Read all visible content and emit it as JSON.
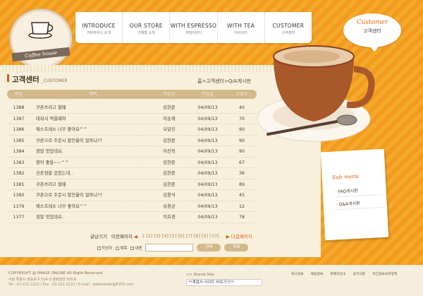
{
  "logo": {
    "brand": "Coffee house"
  },
  "nav": [
    {
      "en": "INTRODUCE",
      "ko": "커피하우스 소개"
    },
    {
      "en": "OUR STORE",
      "ko": "가맹점 소개"
    },
    {
      "en": "WITH ESPRESSO",
      "ko": "커피이야기"
    },
    {
      "en": "WITH TEA",
      "ko": "티이야기"
    },
    {
      "en": "CUSTOMER",
      "ko": "고객센터"
    }
  ],
  "bubble": {
    "en": "Customer",
    "ko": "고객센터"
  },
  "page": {
    "title": "고객센터",
    "subtitle": "_CUSTOMER",
    "breadcrumb": "홈>고객센터>Q/A게시판"
  },
  "table": {
    "headers": [
      "번호",
      "제목",
      "작성자",
      "작성일",
      "조회수"
    ],
    "rows": [
      {
        "no": "1388",
        "title": "쿠폰쓰려고 할때",
        "author": "김현준",
        "date": "04/09/13",
        "views": "40"
      },
      {
        "no": "1387",
        "title": "데워서 먹을때여",
        "author": "이순재",
        "date": "04/09/13",
        "views": "70"
      },
      {
        "no": "1386",
        "title": "에스프레소 너무 좋아요^^",
        "author": "오달진",
        "date": "04/09/13",
        "views": "90"
      },
      {
        "no": "1385",
        "title": "쿠폰으로 주문시 할인율이 얼마나??",
        "author": "김현준",
        "date": "04/09/13",
        "views": "90"
      },
      {
        "no": "1384",
        "title": "정말 맛있네요.",
        "author": "이진혁",
        "date": "04/09/13",
        "views": "90"
      },
      {
        "no": "1383",
        "title": "향이 좋을~~^^",
        "author": "김현준",
        "date": "04/09/13",
        "views": "67"
      },
      {
        "no": "1382",
        "title": "신촌점을 갔었는데..",
        "author": "김현준",
        "date": "04/09/13",
        "views": "36"
      },
      {
        "no": "1381",
        "title": "쿠폰쓰려고 할때",
        "author": "김현준",
        "date": "04/09/13",
        "views": "89"
      },
      {
        "no": "1380",
        "title": "쿠폰으로 주문시 할인율이 얼마나??",
        "author": "김용석",
        "date": "04/09/13",
        "views": "45"
      },
      {
        "no": "1379",
        "title": "에스프레소 너무 좋아요^^",
        "author": "유용균",
        "date": "04/09/13",
        "views": "12"
      },
      {
        "no": "1377",
        "title": "정말 맛있네요.",
        "author": "이호경",
        "date": "04/09/13",
        "views": "78"
      }
    ]
  },
  "pager": {
    "write": "글남기기",
    "prev": "이전페이지",
    "pages": "1 [2] [3] [4] [5] [6] [7] [8] [9] [10]..",
    "next": "다음페이지"
  },
  "search": {
    "opt1": "작성자",
    "opt2": "제목",
    "opt3": "내용",
    "btn1": "검색",
    "btn2": "목록"
  },
  "submenu": {
    "title": "Sub menu",
    "items": [
      "FAQ게시판",
      "Q&A게시판"
    ]
  },
  "footer": {
    "copyright": "COPYRIGHT @ IMAGE ONLINE All Right Reserved",
    "address": "서울 특별시 영등포구 534-3 영화빌딩 505호",
    "contact": "Tel : 02-222-2222  /  Fax : 02-222-2222  /  E-mail : webmaster@EYOS.com",
    "family_label": ">> Brand Site",
    "family_value": "**계열사 사이트 바로가기**",
    "links": [
      "회사정보",
      "채용정보",
      "판매자안내",
      "공지사항",
      "개인정보보호정책"
    ]
  }
}
